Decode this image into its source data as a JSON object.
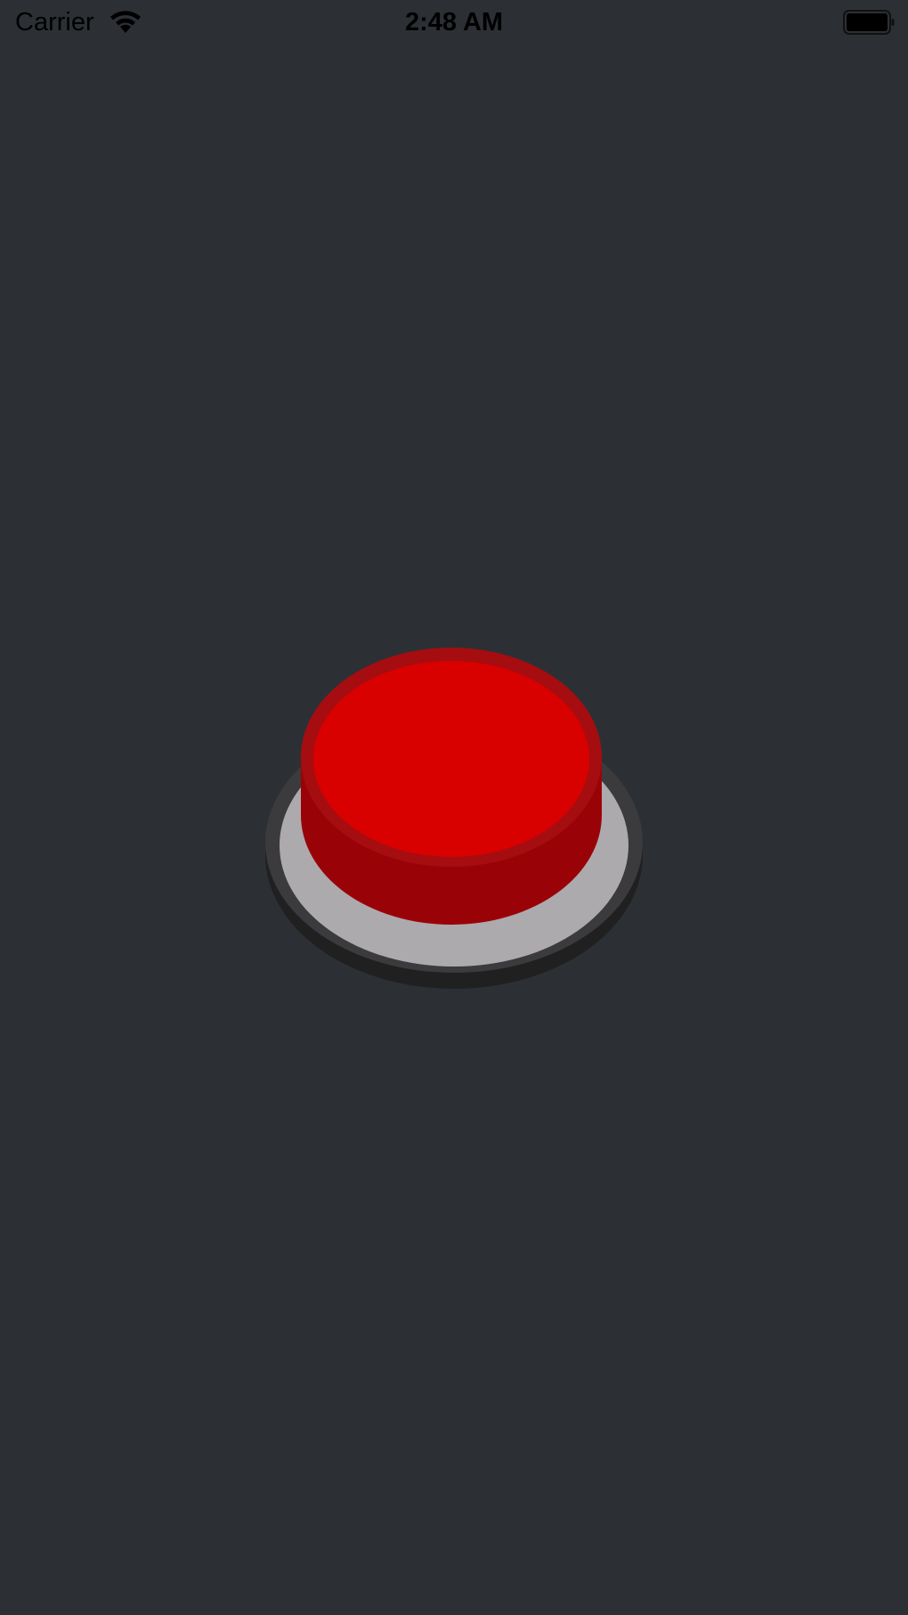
{
  "status_bar": {
    "carrier": "Carrier",
    "time": "2:48 AM",
    "wifi_icon": "wifi-icon",
    "battery_icon": "battery-icon"
  },
  "main": {
    "button_icon": "red-push-button",
    "colors": {
      "background": "#2c3034",
      "button_top": "#d90000",
      "button_rim": "#a50d10",
      "button_side": "#990308",
      "base_plate": "#adaaae",
      "base_ring": "#3b3b3d",
      "base_shadow": "#202020"
    }
  }
}
